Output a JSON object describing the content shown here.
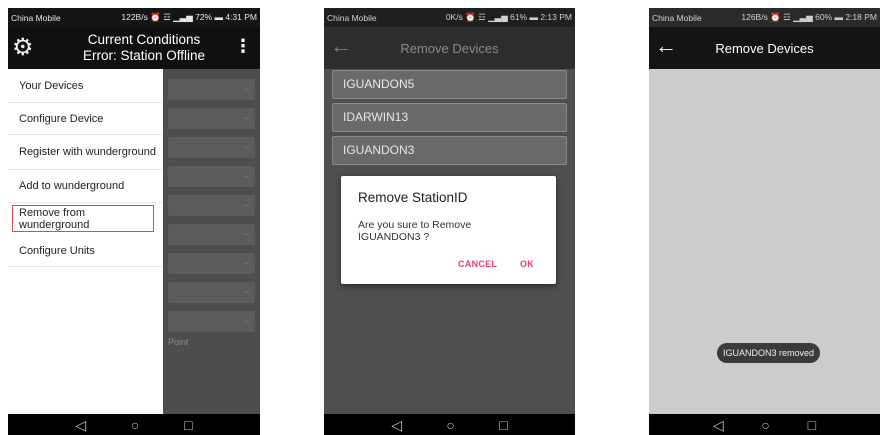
{
  "screens": [
    {
      "status": {
        "carrier": "China Mobile",
        "right": "122B/s ⏰ ☲ ▁▃▅ 72% ▬ 4:31 PM"
      },
      "appbar": {
        "title_line1": "Current Conditions",
        "title_line2": "Error: Station Offline"
      },
      "drawer": {
        "items": [
          {
            "label": "Your Devices"
          },
          {
            "label": "Configure Device"
          },
          {
            "label": "Register with wunderground"
          },
          {
            "label": "Add to wunderground"
          },
          {
            "label": "Remove from wunderground"
          },
          {
            "label": "Configure Units"
          }
        ]
      },
      "background": {
        "row_value": "--",
        "point_label": "Point"
      }
    },
    {
      "status": {
        "carrier": "China Mobile",
        "right": "0K/s ⏰ ☲ ▁▃▅ 61% ▬ 2:13 PM"
      },
      "appbar": {
        "title": "Remove Devices"
      },
      "devices": [
        "IGUANDON5",
        "IDARWIN13",
        "IGUANDON3"
      ],
      "dialog": {
        "title": "Remove StationID",
        "message": "Are you sure to Remove IGUANDON3 ?",
        "cancel": "CANCEL",
        "ok": "OK"
      }
    },
    {
      "status": {
        "carrier": "China Mobile",
        "right": "126B/s ⏰ ☲ ▁▃▅ 60% ▬ 2:18 PM"
      },
      "appbar": {
        "title": "Remove Devices"
      },
      "toast": "IGUANDON3 removed"
    }
  ],
  "navbar": {
    "back": "◁",
    "home": "○",
    "recents": "□"
  },
  "icons": {
    "settings": "gear-icon",
    "overflow": "more-vert-icon",
    "back": "arrow-back-icon"
  }
}
